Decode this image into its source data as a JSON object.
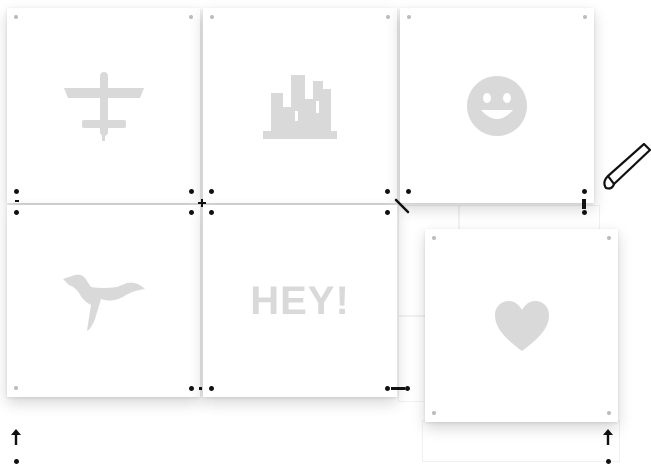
{
  "tiles": [
    {
      "id": "airplane",
      "icon": "airplane-icon"
    },
    {
      "id": "city",
      "icon": "city-skyline-icon"
    },
    {
      "id": "smiley",
      "icon": "smiley-face-icon"
    },
    {
      "id": "bird",
      "icon": "flying-bird-icon"
    },
    {
      "id": "hey",
      "icon": "text-tile",
      "text": "HEY!"
    },
    {
      "id": "heart",
      "icon": "heart-icon"
    }
  ],
  "colors": {
    "background": "#ffffff",
    "tile": "#ffffff",
    "glyph": "#d9d9d9",
    "corner_dot": "#bdbdbd",
    "pin": "#111111"
  },
  "tools": {
    "pen": "pen-icon"
  }
}
